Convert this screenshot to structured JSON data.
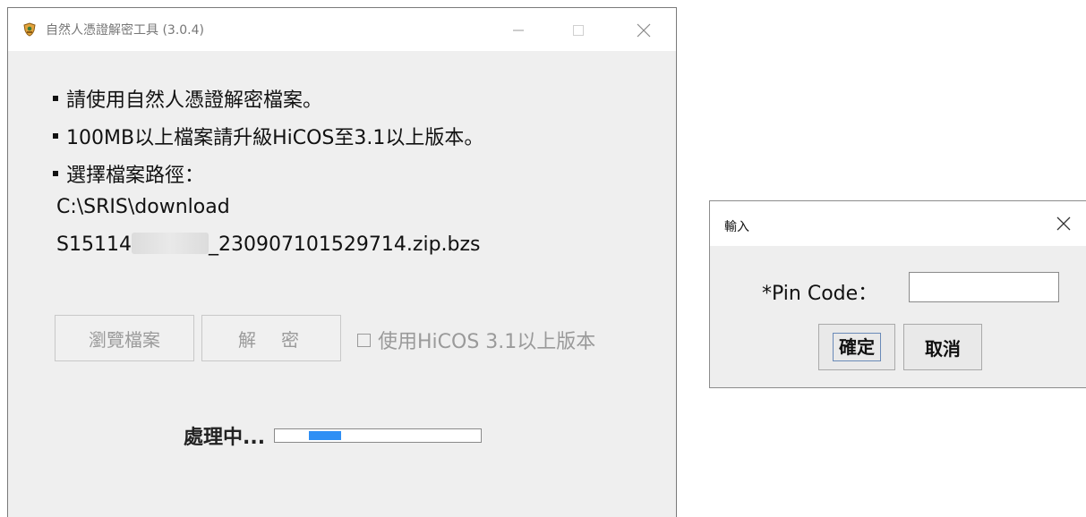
{
  "main_window": {
    "title": "自然人憑證解密工具 (3.0.4)",
    "controls": {
      "minimize": "–",
      "maximize": "☐",
      "close": "✕"
    },
    "instructions": [
      "請使用自然人憑證解密檔案。",
      "100MB以上檔案請升級HiCOS至3.1以上版本。",
      "選擇檔案路徑："
    ],
    "file_path": {
      "directory": "C:\\SRIS\\download",
      "file_prefix": "S15114",
      "file_suffix": "_230907101529714.zip.bzs"
    },
    "buttons": {
      "browse": "瀏覽檔案",
      "decrypt": "解密"
    },
    "hicos_checkbox": {
      "label": "使用HiCOS 3.1以上版本",
      "checked": false
    },
    "status": {
      "label": "處理中...",
      "progress_indeterminate_segment": {
        "start": 0.16,
        "end": 0.32
      }
    }
  },
  "pin_dialog": {
    "title": "輸入",
    "close": "✕",
    "pin_label": "*Pin Code：",
    "pin_value": "",
    "ok_label": "確定",
    "cancel_label": "取消"
  },
  "colors": {
    "window_bg": "#efefef",
    "titlebar_bg": "#ffffff",
    "progress_fill": "#2f8ff4",
    "disabled_text": "#9a9a9a"
  }
}
